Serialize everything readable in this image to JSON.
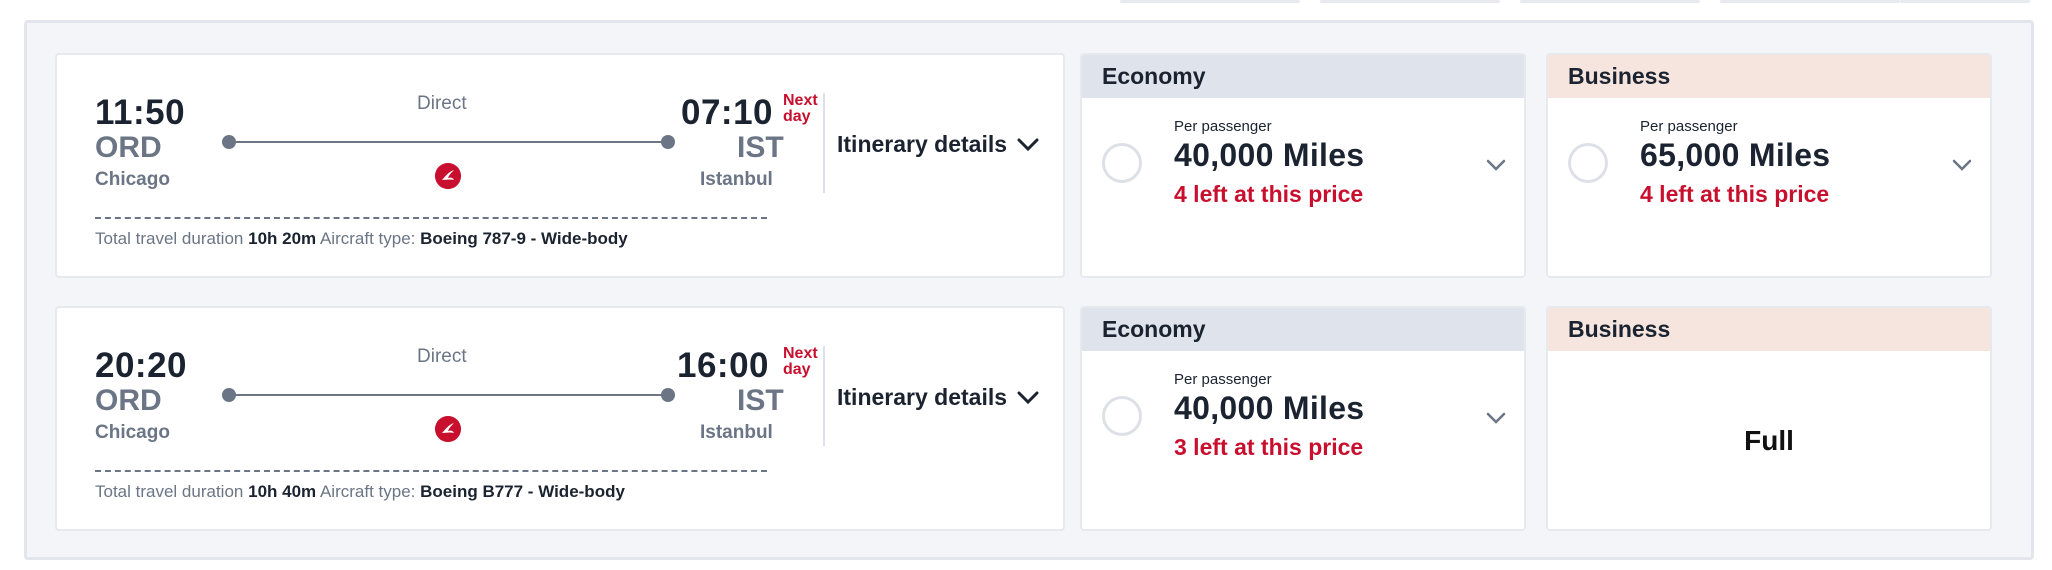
{
  "flights": [
    {
      "departure": {
        "time": "11:50",
        "code": "ORD",
        "city": "Chicago"
      },
      "arrival": {
        "time": "07:10",
        "code": "IST",
        "city": "Istanbul",
        "next_day": "Next day"
      },
      "stops": "Direct",
      "itinerary_label": "Itinerary details",
      "duration_label": "Total travel duration",
      "duration": "10h 20m",
      "aircraft_label": "Aircraft type:",
      "aircraft": "Boeing 787-9 - Wide-body",
      "economy": {
        "title": "Economy",
        "per": "Per passenger",
        "miles": "40,000 Miles",
        "availability": "4 left at this price"
      },
      "business": {
        "title": "Business",
        "per": "Per passenger",
        "miles": "65,000 Miles",
        "availability": "4 left at this price"
      }
    },
    {
      "departure": {
        "time": "20:20",
        "code": "ORD",
        "city": "Chicago"
      },
      "arrival": {
        "time": "16:00",
        "code": "IST",
        "city": "Istanbul",
        "next_day": "Next day"
      },
      "stops": "Direct",
      "itinerary_label": "Itinerary details",
      "duration_label": "Total travel duration",
      "duration": "10h 40m",
      "aircraft_label": "Aircraft type:",
      "aircraft": "Boeing B777 - Wide-body",
      "economy": {
        "title": "Economy",
        "per": "Per passenger",
        "miles": "40,000 Miles",
        "availability": "3 left at this price"
      },
      "business": {
        "title": "Business",
        "status": "Full"
      }
    }
  ],
  "colors": {
    "accent_red": "#c8102e",
    "economy_header": "#dfe4ec",
    "business_header": "#f6e5df",
    "muted_text": "#6b7585"
  },
  "icons": [
    "turkish-airlines-logo-icon",
    "chevron-down-icon",
    "radio-button-icon"
  ]
}
